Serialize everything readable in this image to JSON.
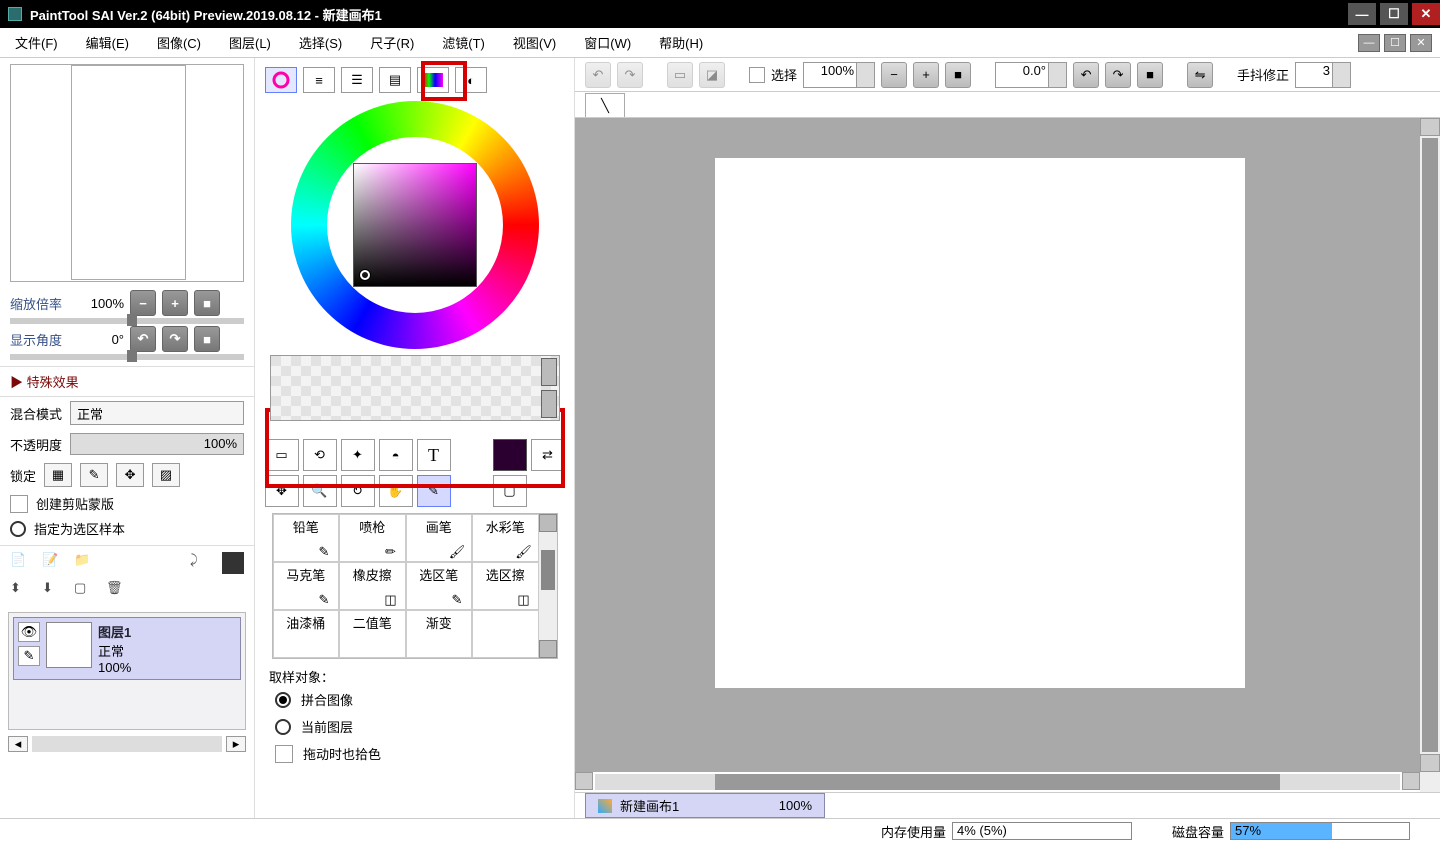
{
  "title": "PaintTool SAI Ver.2 (64bit) Preview.2019.08.12 - 新建画布1",
  "menu": [
    "文件(F)",
    "编辑(E)",
    "图像(C)",
    "图层(L)",
    "选择(S)",
    "尺子(R)",
    "滤镜(T)",
    "视图(V)",
    "窗口(W)",
    "帮助(H)"
  ],
  "left": {
    "zoom_label": "缩放倍率",
    "zoom_value": "100%",
    "angle_label": "显示角度",
    "angle_value": "0°",
    "special_effects": "▶ 特殊效果",
    "blend_label": "混合模式",
    "blend_value": "正常",
    "opacity_label": "不透明度",
    "opacity_value": "100%",
    "lock_label": "锁定",
    "clip_mask": "创建剪贴蒙版",
    "sel_sample": "指定为选区样本"
  },
  "layer": {
    "name": "图层1",
    "mode": "正常",
    "opacity": "100%"
  },
  "brushes": [
    "铅笔",
    "喷枪",
    "画笔",
    "水彩笔",
    "马克笔",
    "橡皮擦",
    "选区笔",
    "选区擦",
    "油漆桶",
    "二值笔",
    "渐变",
    ""
  ],
  "sample": {
    "title": "取样对象：",
    "merged": "拼合图像",
    "current": "当前图层",
    "drag_pick": "拖动时也拾色"
  },
  "canvas": {
    "select_label": "选择",
    "zoom": "100%",
    "angle": "0.0°",
    "stab_label": "手抖修正",
    "stab_value": "3",
    "doc_name": "新建画布1",
    "doc_zoom": "100%"
  },
  "status": {
    "mem_label": "内存使用量",
    "mem_value": "4% (5%)",
    "disk_label": "磁盘容量",
    "disk_value": "57%"
  }
}
